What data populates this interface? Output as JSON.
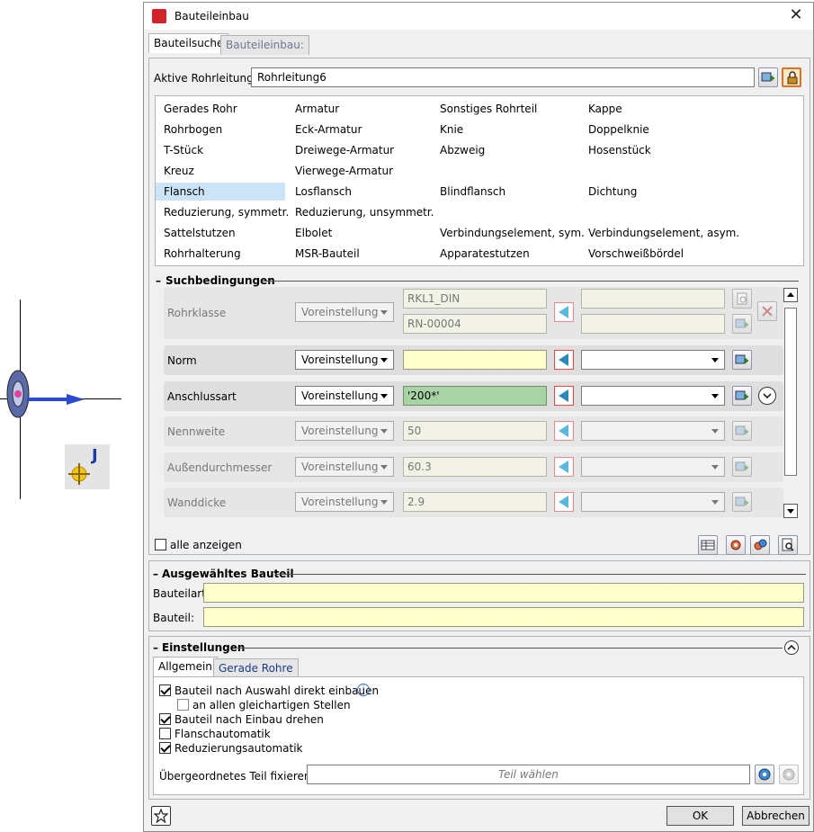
{
  "window": {
    "title": "Bauteileinbau"
  },
  "tabs": [
    {
      "label": "Bauteilsuche",
      "active": true
    },
    {
      "label": "Bauteileinbau:",
      "active": false
    }
  ],
  "pipeline": {
    "label": "Aktive Rohrleitung:",
    "value": "Rohrleitung6"
  },
  "categories": [
    [
      "Gerades Rohr",
      "Armatur",
      "Sonstiges Rohrteil",
      "Kappe"
    ],
    [
      "Rohrbogen",
      "Eck-Armatur",
      "Knie",
      "Doppelknie"
    ],
    [
      "T-Stück",
      "Dreiwege-Armatur",
      "Abzweig",
      "Hosenstück"
    ],
    [
      "Kreuz",
      "Vierwege-Armatur",
      "",
      ""
    ],
    [
      "Flansch",
      "Losflansch",
      "Blindflansch",
      "Dichtung"
    ],
    [
      "Reduzierung, symmetr.",
      "Reduzierung, unsymmetr.",
      "",
      ""
    ],
    [
      "Sattelstutzen",
      "Elbolet",
      "Verbindungselement, sym.",
      "Verbindungselement, asym."
    ],
    [
      "Rohrhalterung",
      "MSR-Bauteil",
      "Apparatestutzen",
      "Vorschweißbördel"
    ]
  ],
  "selected_category": "Flansch",
  "search": {
    "title": "Suchbedingungen",
    "rohrklasse": {
      "label": "Rohrklasse",
      "mode": "Voreinstellung",
      "value1": "RKL1_DIN",
      "value2": "RN-00004"
    },
    "rows": [
      {
        "label": "Norm",
        "mode": "Voreinstellung",
        "value": "",
        "style": "yellow",
        "active": true
      },
      {
        "label": "Anschlussart",
        "mode": "Voreinstellung",
        "value": "'200*'",
        "style": "green",
        "active": true
      },
      {
        "label": "Nennweite",
        "mode": "Voreinstellung",
        "value": "50",
        "style": "grey",
        "active": false
      },
      {
        "label": "Außendurchmesser",
        "mode": "Voreinstellung",
        "value": "60.3",
        "style": "grey",
        "active": false
      },
      {
        "label": "Wanddicke",
        "mode": "Voreinstellung",
        "value": "2.9",
        "style": "grey",
        "active": false
      }
    ],
    "show_all": "alle anzeigen"
  },
  "selected_part": {
    "title": "Ausgewähltes Bauteil",
    "type_label": "Bauteilart:",
    "type_value": "",
    "part_label": "Bauteil:",
    "part_value": ""
  },
  "settings": {
    "title": "Einstellungen",
    "tabs": [
      {
        "label": "Allgemein",
        "active": true
      },
      {
        "label": "Gerade Rohre",
        "active": false
      }
    ],
    "options": [
      {
        "label": "Bauteil nach Auswahl direkt einbauen",
        "checked": true
      },
      {
        "label": "an allen gleichartigen Stellen",
        "checked": false
      },
      {
        "label": "Bauteil nach Einbau drehen",
        "checked": true
      },
      {
        "label": "Flanschautomatik",
        "checked": false
      },
      {
        "label": "Reduzierungsautomatik",
        "checked": true
      }
    ],
    "parent_label": "Übergeordnetes Teil fixieren:",
    "parent_placeholder": "Teil wählen"
  },
  "buttons": {
    "ok": "OK",
    "cancel": "Abbrechen"
  },
  "colors": {
    "accent_red": "#e04a4a",
    "selection_blue": "#cce4f7",
    "yellow_field": "#ffffcc",
    "green_field": "#a7d3a5"
  },
  "cad_marker": "J"
}
